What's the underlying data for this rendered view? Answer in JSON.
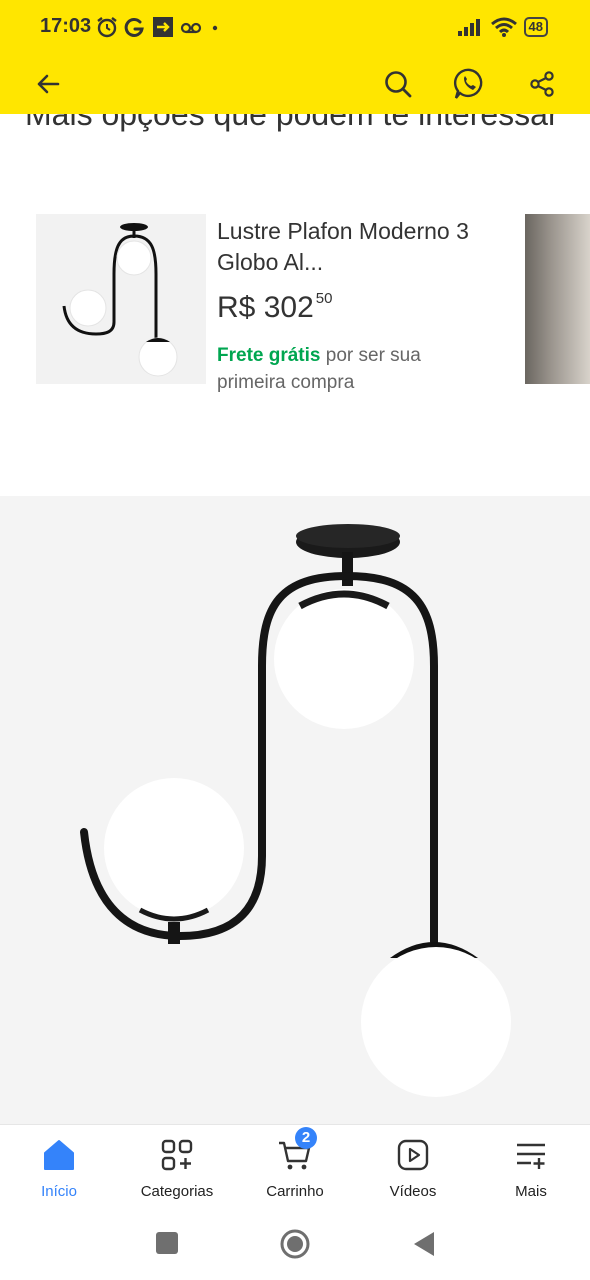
{
  "status_bar": {
    "time": "17:03",
    "battery": "48"
  },
  "app_bar": {
    "back_icon": "arrow-left-icon",
    "actions": [
      "search-icon",
      "whatsapp-icon",
      "share-icon"
    ]
  },
  "section": {
    "title": "Mais opções que podem te interessar"
  },
  "product_card": {
    "title": "Lustre Plafon Moderno 3 Globo Al...",
    "currency": "R$",
    "price_int": "302",
    "price_cents": "50",
    "shipping_free": "Frete grátis",
    "shipping_rest": "por ser sua primeira compra"
  },
  "bottom_nav": {
    "items": [
      {
        "label": "Início",
        "icon": "home-icon",
        "active": true
      },
      {
        "label": "Categorias",
        "icon": "categories-icon",
        "active": false
      },
      {
        "label": "Carrinho",
        "icon": "cart-icon",
        "active": false
      },
      {
        "label": "Vídeos",
        "icon": "video-icon",
        "active": false
      },
      {
        "label": "Mais",
        "icon": "menu-icon",
        "active": false
      }
    ],
    "cart_badge": "2"
  },
  "colors": {
    "brand_yellow": "#ffe600",
    "accent_blue": "#3483fa",
    "free_shipping_green": "#00a650"
  }
}
